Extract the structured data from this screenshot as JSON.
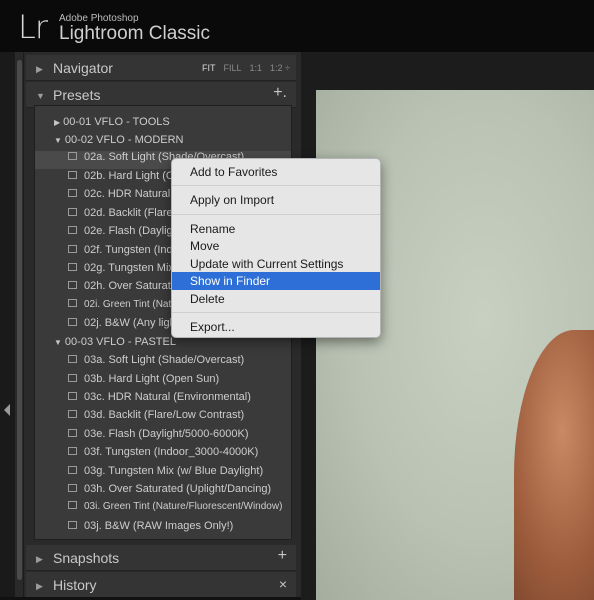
{
  "app": {
    "logo": "Lr",
    "vendor": "Adobe Photoshop",
    "name": "Lightroom Classic"
  },
  "navigator": {
    "title": "Navigator",
    "zoom_options": [
      "FIT",
      "FILL",
      "1:1",
      "1:2 ÷"
    ],
    "active_zoom": "FIT"
  },
  "presets": {
    "title": "Presets",
    "add_symbol": "+.",
    "rows": [
      {
        "type": "folder",
        "expanded": false,
        "label": "00-01 VFLO - TOOLS"
      },
      {
        "type": "folder",
        "expanded": true,
        "label": "00-02 VFLO - MODERN"
      },
      {
        "type": "preset",
        "label": "02a. Soft Light (Shade/Overcast)",
        "selected": true
      },
      {
        "type": "preset",
        "label": "02b. Hard Light (Open Sun)"
      },
      {
        "type": "preset",
        "label": "02c. HDR Natural (Environmental)"
      },
      {
        "type": "preset",
        "label": "02d. Backlit (Flare/Low Contrast)"
      },
      {
        "type": "preset",
        "label": "02e. Flash (Daylight/5000-6000K)"
      },
      {
        "type": "preset",
        "label": "02f. Tungsten (Indoor_3000-4000K)"
      },
      {
        "type": "preset",
        "label": "02g. Tungsten Mix (w/ Blue Daylight)"
      },
      {
        "type": "preset",
        "label": "02h. Over Saturated (Uplight/Dancing)"
      },
      {
        "type": "preset",
        "label": "02i. Green Tint (Nature/Fluorescent/Window)"
      },
      {
        "type": "preset",
        "label": "02j. B&W (Any lighting)"
      },
      {
        "type": "folder",
        "expanded": true,
        "label": "00-03 VFLO - PASTEL"
      },
      {
        "type": "preset",
        "label": "03a. Soft Light (Shade/Overcast)"
      },
      {
        "type": "preset",
        "label": "03b. Hard Light (Open Sun)"
      },
      {
        "type": "preset",
        "label": "03c. HDR Natural (Environmental)"
      },
      {
        "type": "preset",
        "label": "03d. Backlit (Flare/Low Contrast)"
      },
      {
        "type": "preset",
        "label": "03e. Flash (Daylight/5000-6000K)"
      },
      {
        "type": "preset",
        "label": "03f. Tungsten (Indoor_3000-4000K)"
      },
      {
        "type": "preset",
        "label": "03g. Tungsten Mix (w/ Blue Daylight)"
      },
      {
        "type": "preset",
        "label": "03h. Over Saturated (Uplight/Dancing)"
      },
      {
        "type": "preset",
        "label": "03i. Green Tint (Nature/Fluorescent/Window)"
      },
      {
        "type": "preset",
        "label": "03j. B&W (RAW Images Only!)"
      }
    ]
  },
  "snapshots": {
    "title": "Snapshots",
    "add_symbol": "+"
  },
  "history": {
    "title": "History",
    "clear_symbol": "×"
  },
  "context_menu": {
    "items": [
      {
        "label": "Add to Favorites"
      },
      {
        "label": "Apply on Import"
      },
      {
        "label": "Rename"
      },
      {
        "label": "Move"
      },
      {
        "label": "Update with Current Settings"
      },
      {
        "label": "Show in Finder",
        "highlighted": true
      },
      {
        "label": "Delete"
      },
      {
        "label": "Export..."
      }
    ]
  },
  "colors": {
    "menu_highlight": "#2d6fd6",
    "panel_bg": "#2a2a2a",
    "preset_box_bg": "#3a3a3a"
  }
}
